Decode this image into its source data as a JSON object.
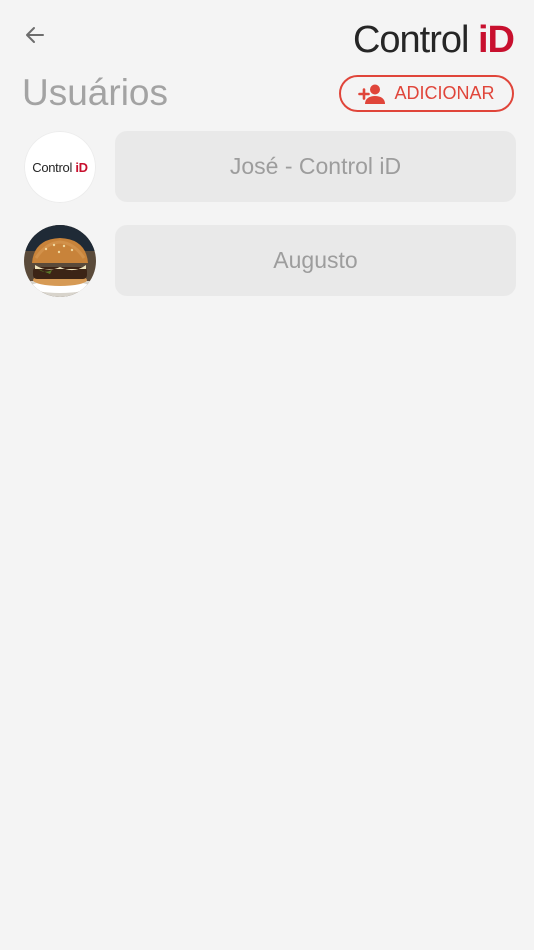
{
  "header": {
    "back_icon": "arrow-left-icon",
    "logo": {
      "word1": "Control",
      "word2": "iD"
    }
  },
  "page": {
    "title": "Usuários",
    "add_button_label": "ADICIONAR",
    "add_button_icon": "person-add-icon"
  },
  "users": [
    {
      "name": "José - Control iD",
      "avatar": "control-id-logo",
      "avatar_text": {
        "word1": "Control",
        "word2": "iD"
      }
    },
    {
      "name": "Augusto",
      "avatar": "burger-photo"
    }
  ],
  "colors": {
    "accent": "#e0453a",
    "brand_red": "#c8102e",
    "background": "#f4f4f4",
    "title_gray": "#a3a3a3",
    "pill_bg": "#e9e9e9"
  }
}
